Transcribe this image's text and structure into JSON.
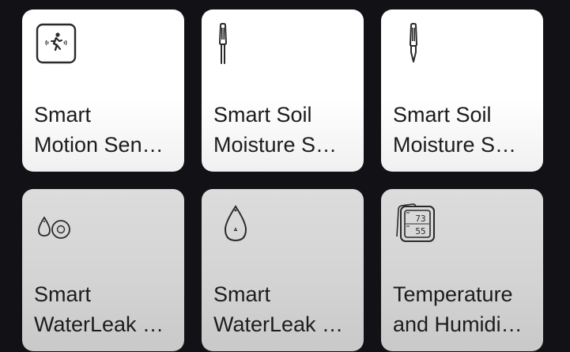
{
  "devices": [
    {
      "line1": "Smart",
      "line2": "Motion Sen…",
      "icon": "motion-sensor-icon",
      "state": "online"
    },
    {
      "line1": "Smart Soil",
      "line2": "Moisture S…",
      "icon": "soil-probe-icon",
      "state": "online"
    },
    {
      "line1": "Smart Soil",
      "line2": "Moisture S…",
      "icon": "soil-probe-icon",
      "state": "online"
    },
    {
      "line1": "Smart",
      "line2": "WaterLeak …",
      "icon": "water-leak-sensor-icon",
      "state": "offline"
    },
    {
      "line1": "Smart",
      "line2": "WaterLeak …",
      "icon": "water-drop-sensor-icon",
      "state": "offline"
    },
    {
      "line1": "Temperature",
      "line2": "and Humidi…",
      "icon": "thermo-hygrometer-icon",
      "state": "offline"
    }
  ],
  "thermo_display": {
    "top": "73",
    "bottom": "55"
  },
  "colors": {
    "background": "#121116",
    "card_online": "#ffffff",
    "card_offline": "#d3d3d3",
    "text": "#1c1c1c",
    "icon_stroke": "#2a2a2a"
  }
}
